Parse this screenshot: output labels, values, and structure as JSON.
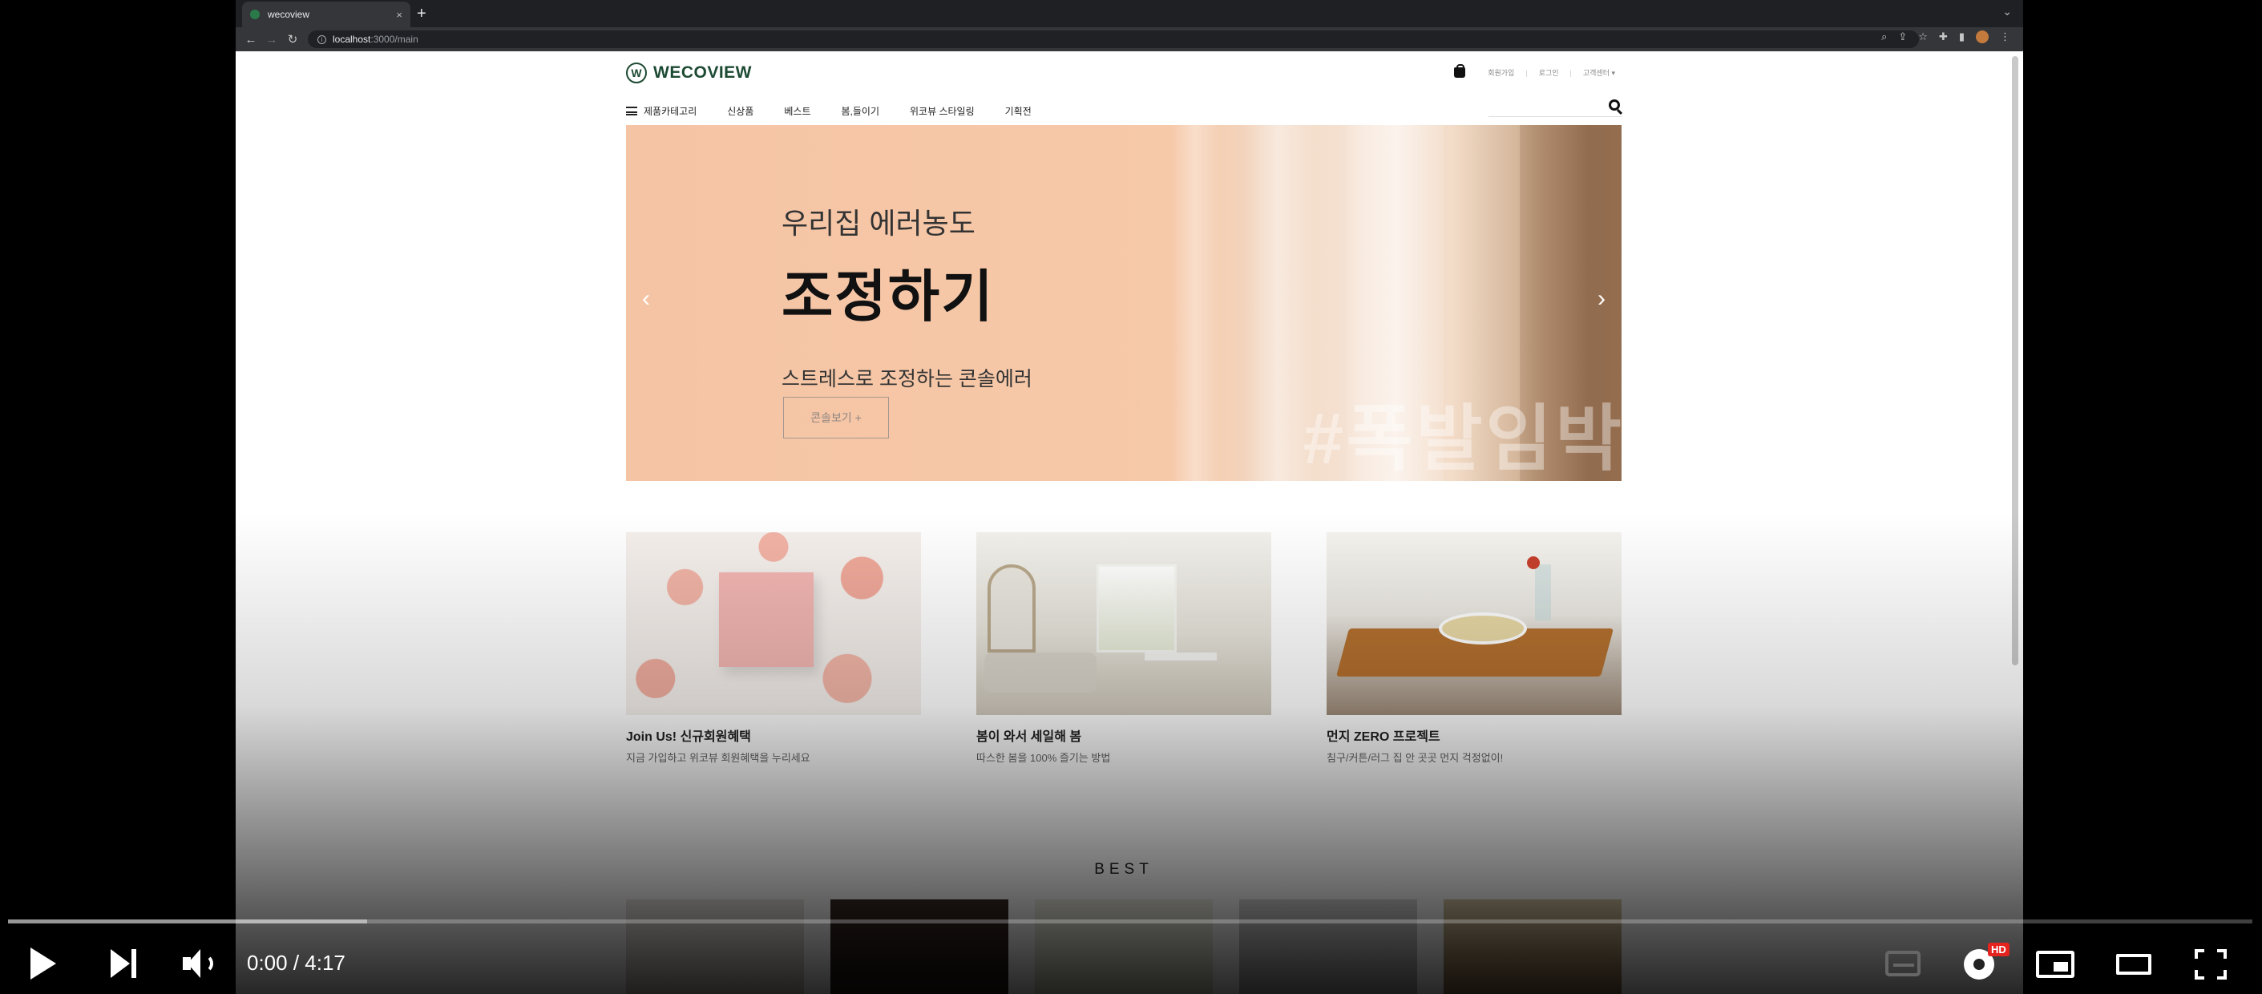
{
  "browser": {
    "tab_title": "wecoview",
    "tab_close": "×",
    "new_tab": "+",
    "tab_menu": "⌄",
    "url_host": "localhost",
    "url_path": ":3000/main",
    "icons": [
      "zoom-icon",
      "share-icon",
      "star-icon",
      "extensions-icon",
      "sidepanel-icon",
      "profile-avatar",
      "menu-icon"
    ]
  },
  "site": {
    "logo_mark": "W",
    "logo_text": "WECOVIEW",
    "util": {
      "join": "회원가입",
      "login": "로그인",
      "support": "고객센터 ▾"
    },
    "nav": {
      "category": "제품카테고리",
      "items": [
        "신상품",
        "베스트",
        "봄,들이기",
        "위코뷰 스타일링",
        "기획전"
      ]
    },
    "search_placeholder": ""
  },
  "hero": {
    "subtitle": "우리집 에러농도",
    "title": "조정하기",
    "description": "스트레스로 조정하는 콘솔에러",
    "button": "콘솔보기 +",
    "prev": "‹",
    "next": "›",
    "hashtag": "#폭발임박"
  },
  "promos": [
    {
      "title": "Join Us! 신규회원혜택",
      "desc": "지금 가입하고 위코뷰 회원혜택을 누리세요"
    },
    {
      "title": "봄이 와서 세일해 봄",
      "desc": "따스한 봄을 100% 즐기는 방법"
    },
    {
      "title": "먼지 ZERO 프로젝트",
      "desc": "침구/커튼/러그 집 안 곳곳 먼지 걱정없이!"
    }
  ],
  "best_title": "BEST",
  "player": {
    "time": "0:00 / 4:17",
    "played_fraction": 0,
    "loaded_fraction": 0.16,
    "hd_badge": "HD",
    "colors": {
      "progress": "#ffffff",
      "hd": "#e5231f"
    }
  }
}
